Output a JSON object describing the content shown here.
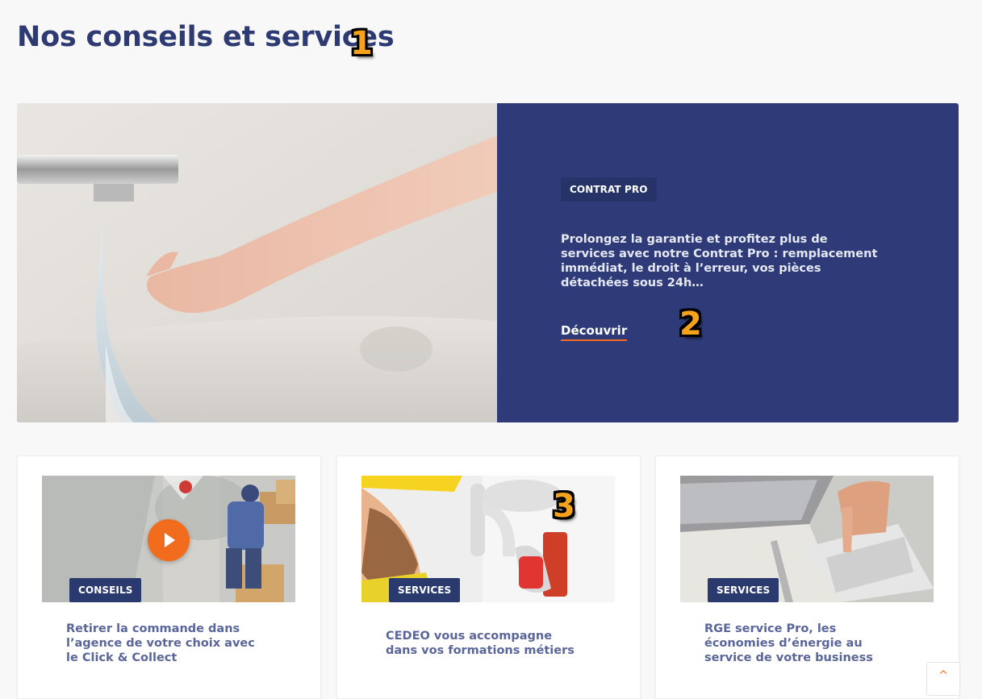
{
  "page": {
    "title": "Nos conseils et services"
  },
  "annotations": [
    "1",
    "2",
    "3"
  ],
  "hero": {
    "badge": "CONTRAT PRO",
    "text": "Prolongez la garantie et profitez plus de services avec notre Contrat Pro : remplacement immédiat, le droit à l’erreur, vos pièces détachées sous 24h…",
    "link": "Découvrir",
    "image": "water-tap-hand-photo"
  },
  "cards": [
    {
      "badge": "CONSEILS",
      "title": "Retirer la commande dans l’agence de votre choix avec le Click & Collect",
      "image": "warehouse-delivery-photo",
      "has_video": true
    },
    {
      "badge": "SERVICES",
      "title": "CEDEO vous accompagne dans vos formations métiers",
      "image": "plumber-repair-photo",
      "has_video": false
    },
    {
      "badge": "SERVICES",
      "title": "RGE service Pro, les économies d’énergie au service de votre business",
      "image": "calculator-laptop-photo",
      "has_video": false
    }
  ],
  "colors": {
    "brand_blue": "#2e3b78",
    "accent_orange": "#f26c21",
    "badge_bg": "#2b3a6e",
    "card_title": "#5a6699"
  },
  "icons": {
    "play": "play-icon",
    "scroll_top": "chevron-up-icon"
  }
}
